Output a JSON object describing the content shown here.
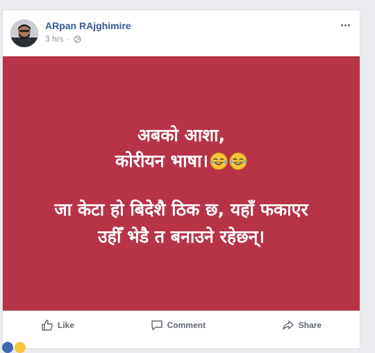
{
  "post": {
    "author": "ARpan RAjghimire",
    "time": "3 hrs",
    "separator": "·",
    "privacy_icon": "globe-icon",
    "background_color": "#b73346",
    "text_lines": [
      "अबको आशा,",
      "कोरीयन भाषा।",
      "जा केटा हो बिदेशै ठिक छ, यहाँ फकाएर",
      "उहीँ भेडै त बनाउने रहेछन्।"
    ],
    "emoji": "face-with-tears-of-joy-icon"
  },
  "actions": {
    "like": "Like",
    "comment": "Comment",
    "share": "Share"
  },
  "colors": {
    "author_link": "#365899",
    "muted": "#90949c",
    "action_text": "#606770"
  }
}
